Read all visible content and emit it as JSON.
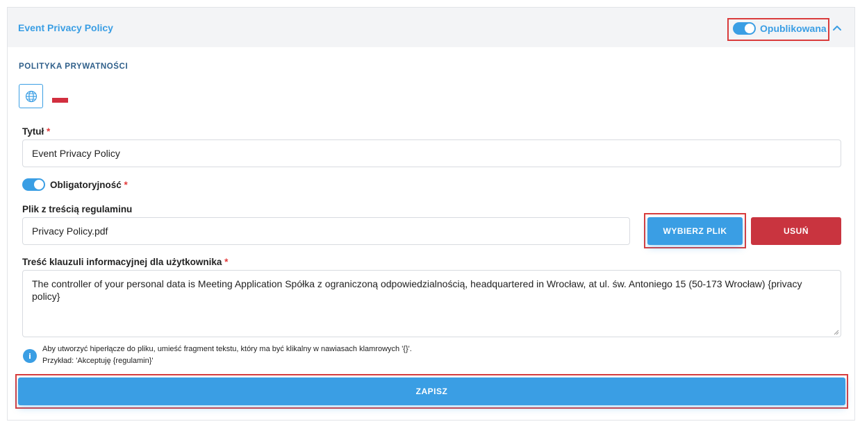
{
  "header": {
    "title": "Event Privacy Policy",
    "published_label": "Opublikowana",
    "published": true
  },
  "section": {
    "title": "POLITYKA PRYWATNOŚCI"
  },
  "language": {
    "globe_icon": "globe-icon",
    "flag": "pl-flag"
  },
  "form": {
    "title_label": "Tytuł",
    "required_mark": "*",
    "title_value": "Event Privacy Policy",
    "mandatory_label": "Obligatoryjność",
    "mandatory": true,
    "file_label": "Plik z treścią regulaminu",
    "file_value": "Privacy Policy.pdf",
    "choose_file_button": "WYBIERZ PLIK",
    "remove_button": "USUŃ",
    "clause_label": "Treść klauzuli informacyjnej dla użytkownika",
    "clause_value": "The controller of your personal data is Meeting Application Spółka z ograniczoną odpowiedzialnością, headquartered in Wrocław, at ul. św. Antoniego 15 (50-173 Wrocław) {privacy policy}",
    "info_line1": "Aby utworzyć hiperłącze do pliku, umieść fragment tekstu, który ma być klikalny w nawiasach klamrowych '{}'.",
    "info_line2": "Przykład: 'Akceptuję {regulamin}'",
    "save_button": "ZAPISZ"
  },
  "colors": {
    "accent": "#3a9ee4",
    "danger": "#c9343f",
    "highlight": "#d93b3b",
    "flag_red": "#d22f3f"
  }
}
